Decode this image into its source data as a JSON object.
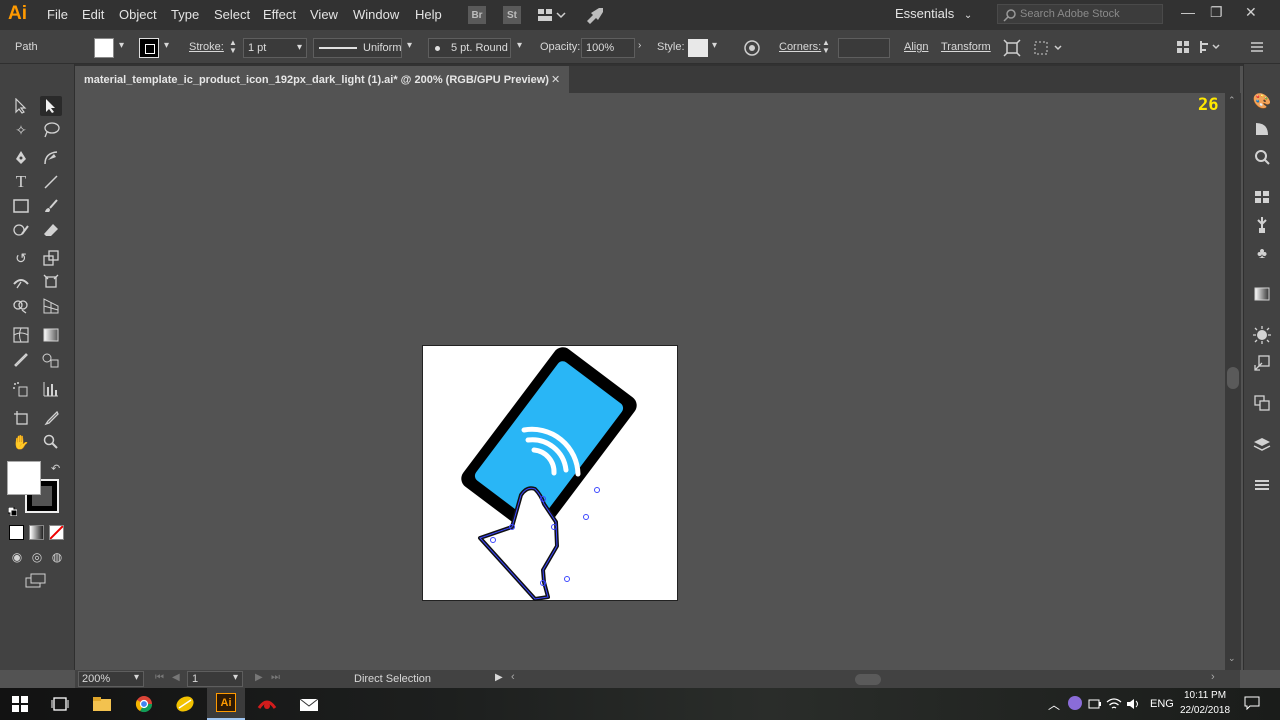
{
  "app": {
    "logo": "Ai"
  },
  "menus": [
    "File",
    "Edit",
    "Object",
    "Type",
    "Select",
    "Effect",
    "View",
    "Window",
    "Help"
  ],
  "menubar_icons": {
    "bridge": "Br",
    "stock": "St"
  },
  "workspace": {
    "label": "Essentials"
  },
  "search": {
    "placeholder": "Search Adobe Stock"
  },
  "control": {
    "selection_label": "Path",
    "stroke_label": "Stroke:",
    "stroke_weight": "1 pt",
    "profile_label": "Uniform",
    "brush_label": "5 pt. Round",
    "opacity_label": "Opacity:",
    "opacity_value": "100%",
    "style_label": "Style:",
    "corners_label": "Corners:",
    "align_label": "Align",
    "transform_label": "Transform"
  },
  "document": {
    "tab_title": "material_template_ic_product_icon_192px_dark_light (1).ai* @ 200% (RGB/GPU Preview)",
    "close_glyph": "✕"
  },
  "counter": "26",
  "status": {
    "zoom": "200%",
    "artboard_number": "1",
    "current_tool": "Direct Selection"
  },
  "taskbar": {
    "language": "ENG",
    "time": "10:11 PM",
    "date": "22/02/2018"
  },
  "colors": {
    "accent_orange": "#ff9a00",
    "phone_screen": "#29b6f6",
    "selection_path": "#3b46ff",
    "counter_yellow": "#ffe800"
  }
}
